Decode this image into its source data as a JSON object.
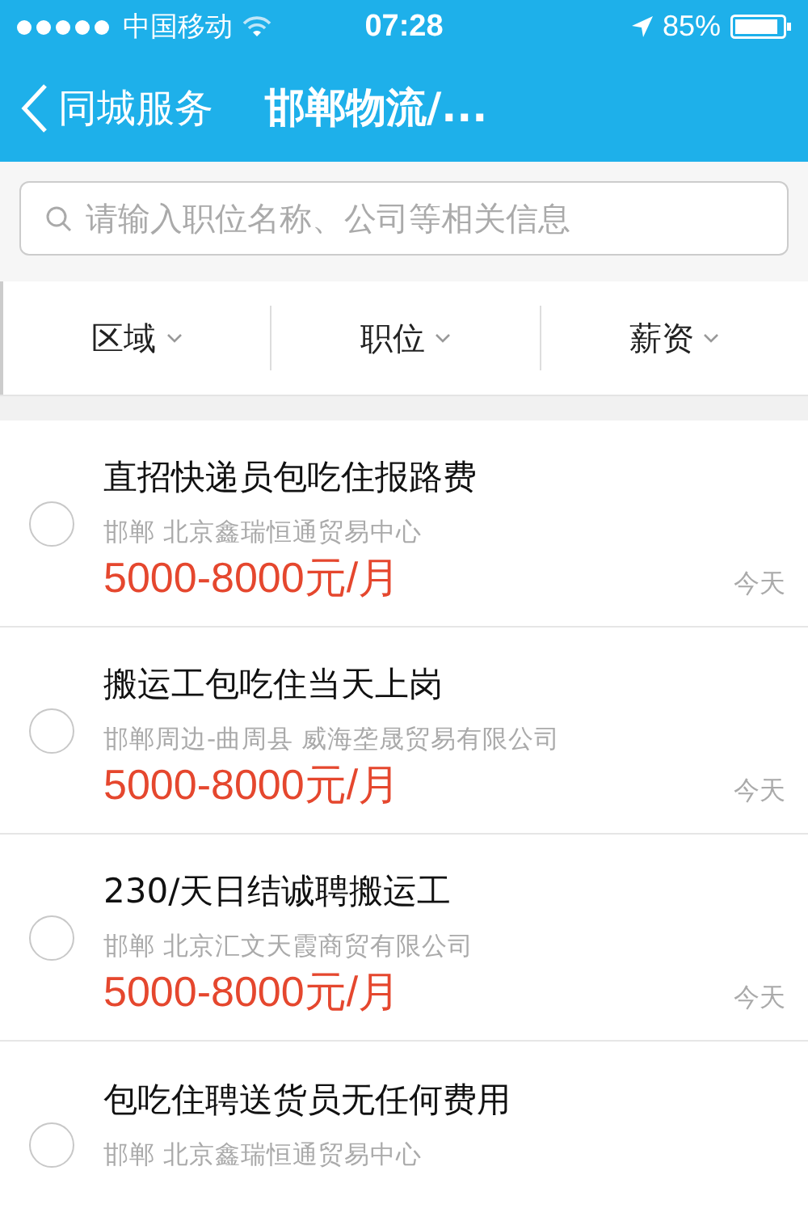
{
  "status_bar": {
    "carrier": "中国移动",
    "time": "07:28",
    "battery": "85%"
  },
  "nav": {
    "back": "同城服务",
    "title": "邯郸物流/..."
  },
  "search": {
    "placeholder": "请输入职位名称、公司等相关信息"
  },
  "filters": [
    "区域",
    "职位",
    "薪资"
  ],
  "jobs": [
    {
      "title": "直招快递员包吃住报路费",
      "company": "邯郸 北京鑫瑞恒通贸易中心",
      "salary": "5000-8000元/月",
      "date": "今天",
      "selected": false
    },
    {
      "title": "搬运工包吃住当天上岗",
      "company": "邯郸周边-曲周县 威海垄晟贸易有限公司",
      "salary": "5000-8000元/月",
      "date": "今天",
      "selected": false
    },
    {
      "title": "230/天日结诚聘搬运工",
      "company": "邯郸 北京汇文天霞商贸有限公司",
      "salary": "5000-8000元/月",
      "date": "今天",
      "selected": false
    },
    {
      "title": "包吃住聘送货员无任何费用",
      "company": "邯郸 北京鑫瑞恒通贸易中心",
      "selected": false
    }
  ]
}
